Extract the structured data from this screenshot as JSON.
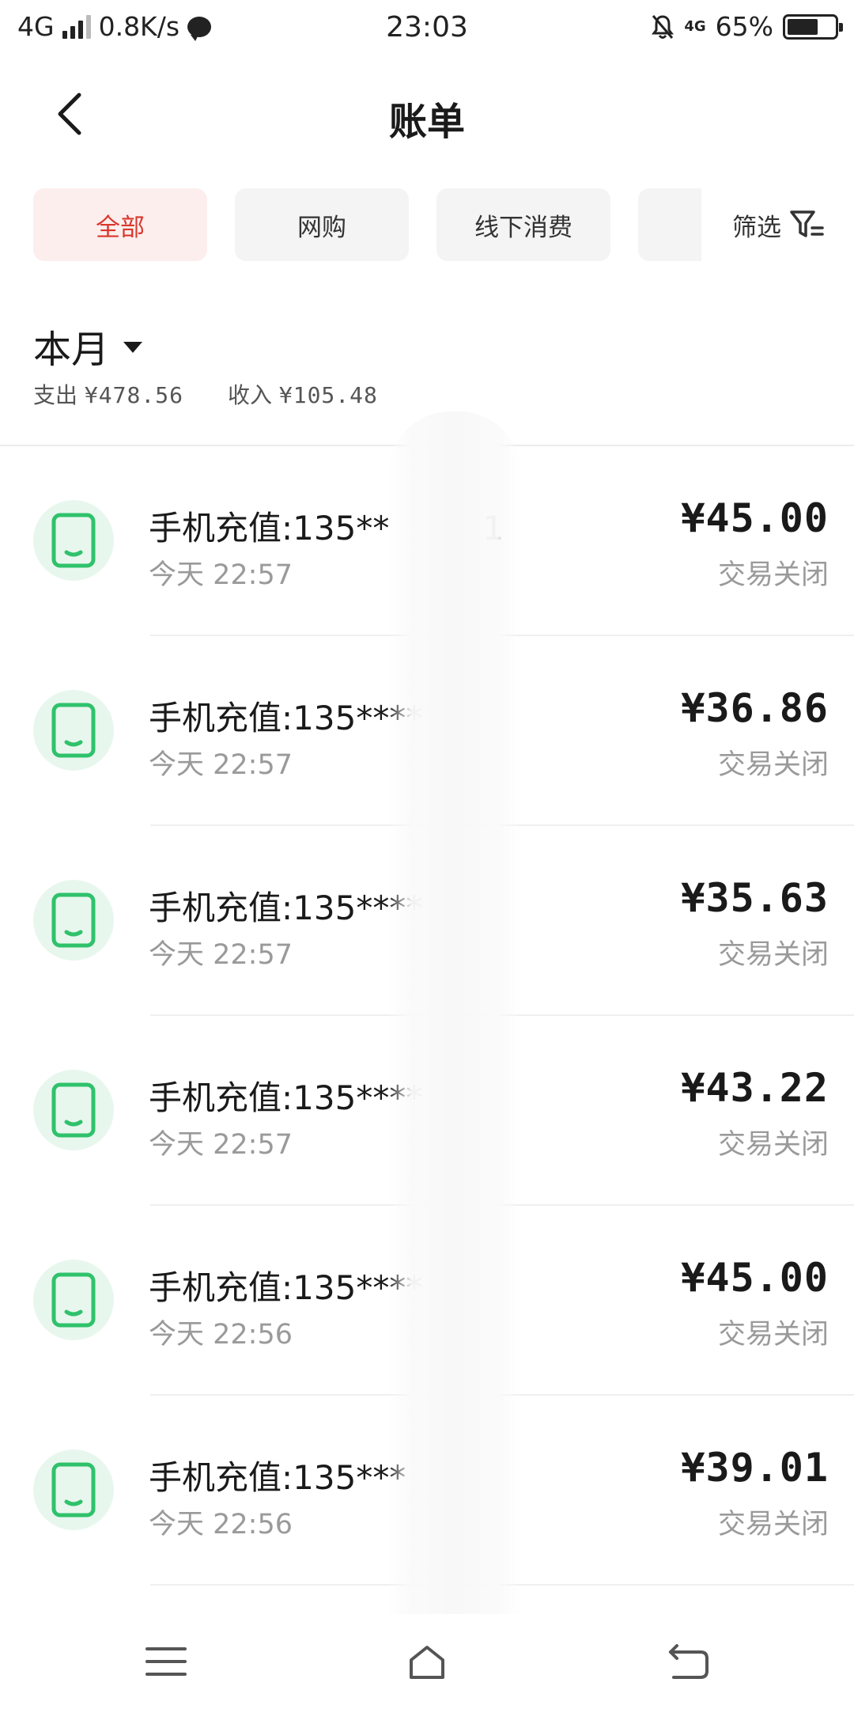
{
  "status_bar": {
    "network": "4G",
    "speed": "0.8K/s",
    "time": "23:03",
    "network_right": "4G",
    "battery": "65%",
    "battery_level": 0.65
  },
  "header": {
    "title": "账单"
  },
  "tabs": [
    {
      "label": "全部",
      "active": true
    },
    {
      "label": "网购",
      "active": false
    },
    {
      "label": "线下消费",
      "active": false
    }
  ],
  "filter": {
    "label": "筛选"
  },
  "summary": {
    "month": "本月",
    "expense_label": "支出",
    "expense_value": "¥478.56",
    "income_label": "收入",
    "income_value": "¥105.48"
  },
  "transactions": [
    {
      "title": "手机充值:135**",
      "title_tail": "1",
      "time": "今天 22:57",
      "amount": "¥45.00",
      "status": "交易关闭"
    },
    {
      "title": "手机充值:135****",
      "title_tail": "",
      "time": "今天 22:57",
      "amount": "¥36.86",
      "status": "交易关闭"
    },
    {
      "title": "手机充值:135****",
      "title_tail": "",
      "time": "今天 22:57",
      "amount": "¥35.63",
      "status": "交易关闭"
    },
    {
      "title": "手机充值:135****",
      "title_tail": "",
      "time": "今天 22:57",
      "amount": "¥43.22",
      "status": "交易关闭"
    },
    {
      "title": "手机充值:135****",
      "title_tail": "",
      "time": "今天 22:56",
      "amount": "¥45.00",
      "status": "交易关闭"
    },
    {
      "title": "手机充值:135***",
      "title_tail": "",
      "time": "今天 22:56",
      "amount": "¥39.01",
      "status": "交易关闭"
    }
  ],
  "colors": {
    "accent": "#d9382c",
    "accent_bg": "#fdeeee",
    "icon_green": "#2fc26b",
    "icon_bg": "#e8f7ee"
  }
}
